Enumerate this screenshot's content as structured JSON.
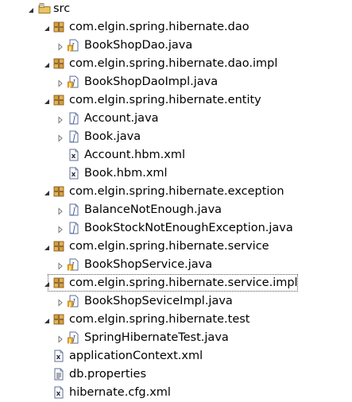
{
  "tree": {
    "rows": [
      {
        "label": "src",
        "depth": 0,
        "twisty": "expanded",
        "icon": "source-folder-icon",
        "name": "tree-item-src"
      },
      {
        "label": "com.elgin.spring.hibernate.dao",
        "depth": 1,
        "twisty": "expanded",
        "icon": "package-icon",
        "name": "tree-item-package-dao"
      },
      {
        "label": "BookShopDao.java",
        "depth": 2,
        "twisty": "collapsed",
        "icon": "java-interface-icon",
        "name": "tree-item-bookshopdao-java"
      },
      {
        "label": "com.elgin.spring.hibernate.dao.impl",
        "depth": 1,
        "twisty": "expanded",
        "icon": "package-icon",
        "name": "tree-item-package-dao-impl"
      },
      {
        "label": "BookShopDaoImpl.java",
        "depth": 2,
        "twisty": "collapsed",
        "icon": "java-class-icon",
        "name": "tree-item-bookshopdaoimpl-java"
      },
      {
        "label": "com.elgin.spring.hibernate.entity",
        "depth": 1,
        "twisty": "expanded",
        "icon": "package-icon",
        "name": "tree-item-package-entity"
      },
      {
        "label": "Account.java",
        "depth": 2,
        "twisty": "collapsed",
        "icon": "java-file-icon",
        "name": "tree-item-account-java"
      },
      {
        "label": "Book.java",
        "depth": 2,
        "twisty": "collapsed",
        "icon": "java-file-icon",
        "name": "tree-item-book-java"
      },
      {
        "label": "Account.hbm.xml",
        "depth": 2,
        "twisty": "none",
        "icon": "xml-file-icon",
        "name": "tree-item-account-hbm-xml"
      },
      {
        "label": "Book.hbm.xml",
        "depth": 2,
        "twisty": "none",
        "icon": "xml-file-icon",
        "name": "tree-item-book-hbm-xml"
      },
      {
        "label": "com.elgin.spring.hibernate.exception",
        "depth": 1,
        "twisty": "expanded",
        "icon": "package-icon",
        "name": "tree-item-package-exception"
      },
      {
        "label": "BalanceNotEnough.java",
        "depth": 2,
        "twisty": "collapsed",
        "icon": "java-file-icon",
        "name": "tree-item-balancenotenough-java"
      },
      {
        "label": "BookStockNotEnoughException.java",
        "depth": 2,
        "twisty": "collapsed",
        "icon": "java-file-icon",
        "name": "tree-item-bookstocknotenoughexception-java"
      },
      {
        "label": "com.elgin.spring.hibernate.service",
        "depth": 1,
        "twisty": "expanded",
        "icon": "package-icon",
        "name": "tree-item-package-service"
      },
      {
        "label": "BookShopService.java",
        "depth": 2,
        "twisty": "collapsed",
        "icon": "java-interface-icon",
        "name": "tree-item-bookshopservice-java"
      },
      {
        "label": "com.elgin.spring.hibernate.service.impl",
        "depth": 1,
        "twisty": "expanded",
        "icon": "package-icon",
        "name": "tree-item-package-service-impl",
        "selected": true
      },
      {
        "label": "BookShopSeviceImpl.java",
        "depth": 2,
        "twisty": "collapsed",
        "icon": "java-class-icon",
        "name": "tree-item-bookshopseviceimpl-java"
      },
      {
        "label": "com.elgin.spring.hibernate.test",
        "depth": 1,
        "twisty": "expanded",
        "icon": "package-icon",
        "name": "tree-item-package-test"
      },
      {
        "label": "SpringHibernateTest.java",
        "depth": 2,
        "twisty": "collapsed",
        "icon": "java-class-icon",
        "name": "tree-item-springhibernatetest-java"
      },
      {
        "label": "applicationContext.xml",
        "depth": 1,
        "twisty": "none",
        "icon": "xml-file-icon",
        "name": "tree-item-applicationcontext-xml"
      },
      {
        "label": "db.properties",
        "depth": 1,
        "twisty": "none",
        "icon": "text-file-icon",
        "name": "tree-item-db-properties"
      },
      {
        "label": "hibernate.cfg.xml",
        "depth": 1,
        "twisty": "none",
        "icon": "xml-file-icon",
        "name": "tree-item-hibernate-cfg-xml"
      }
    ]
  }
}
